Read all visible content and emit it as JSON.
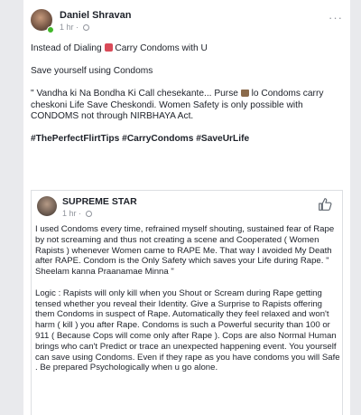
{
  "post": {
    "author": "Daniel Shravan",
    "time": "1 hr",
    "more_icon": "more-dots-icon",
    "paragraphs": [
      {
        "before": "Instead of Dialing ",
        "icon": "hundred-emoji-icon",
        "after": " Carry Condoms with U"
      },
      {
        "text": "Save yourself using Condoms"
      },
      {
        "before": "\" Vandha ki Na Bondha Ki Call chesekante... Purse ",
        "icon": "purse-emoji-icon",
        "after": " lo Condoms carry cheskoni Life Save Cheskondi. Women Safety is only possible with CONDOMS not through NIRBHAYA Act."
      }
    ],
    "hashtags": "#ThePerfectFlirtTips #CarryCondoms #SaveUrLife"
  },
  "shared_post": {
    "author": "SUPREME STAR",
    "time": "1 hr",
    "like_icon": "thumbs-up-icon",
    "paragraphs": [
      "I used Condoms every time, refrained myself shouting, sustained fear of Rape by not screaming and thus not creating a scene and Cooperated ( Women Rapists ) whenever Women came to RAPE Me. That way I avoided My Death after RAPE. Condom is the Only Safety which saves your Life during Rape. \" Sheelam kanna Praanamae Minna \"",
      "Logic : Rapists will only kill when you Shout or Scream during Rape getting tensed whether you reveal their Identity. Give a Surprise to Rapists offering them Condoms in suspect of Rape. Automatically they feel relaxed and won't harm ( kill ) you after Rape. Condoms is such a Powerful security than 100 or 911 ( Because Cops will come only after Rape ). Cops are also Normal Human brings who can't  Predict or trace an unexpected happening event. You yourself can save using Condoms. Even if they rape as you have condoms you will Safe . Be prepared Psychologically when u go alone."
    ]
  },
  "colors": {
    "name": "#1d2129",
    "meta": "#90949c",
    "online": "#42b72a",
    "border": "#dddfe2"
  }
}
